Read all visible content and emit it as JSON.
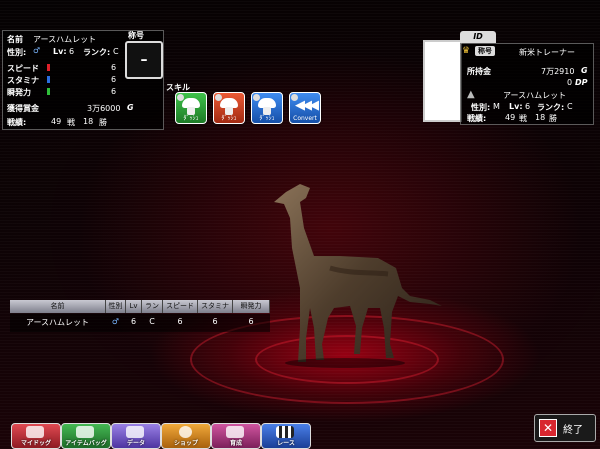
{
  "status": {
    "name_label": "名前",
    "name": "アースハムレット",
    "sex_label": "性別:",
    "sex_symbol": "♂",
    "level_label": "Lv:",
    "level": "6",
    "rank_label": "ランク:",
    "rank": "C",
    "title_label": "称号",
    "title_value": "–",
    "stats": [
      {
        "label": "スピード",
        "value": "6",
        "color": "#e0202a"
      },
      {
        "label": "スタミナ",
        "value": "6",
        "color": "#2a6ee0"
      },
      {
        "label": "瞬発力",
        "value": "6",
        "color": "#2fbf3a"
      }
    ],
    "prize_label": "獲得賞金",
    "prize_value": "3万6000",
    "prize_unit": "G",
    "record_label": "戦績:",
    "record_races": "49",
    "record_races_unit": "戦",
    "record_wins": "18",
    "record_wins_unit": "勝"
  },
  "skills": {
    "label": "スキル",
    "items": [
      {
        "icon": "mushroom-skill-icon",
        "color": "#2fa83a",
        "caption": "ﾀﾞｯｼｭ"
      },
      {
        "icon": "mushroom-skill-icon",
        "color": "#d8411f",
        "caption": "ﾀﾞｯｼｭ"
      },
      {
        "icon": "mushroom-skill-icon",
        "color": "#1f6fd8",
        "caption": "ﾀﾞｯｼｭ"
      },
      {
        "icon": "chevron-skill-icon",
        "color": "#1f6fd8",
        "caption": "Convert"
      }
    ]
  },
  "trainer": {
    "id_label": "ID",
    "title_label": "称号",
    "name": "新米トレーナー",
    "money_label": "所持金",
    "money_value": "7万2910",
    "money_unit": "G",
    "dp_value": "0",
    "dp_unit": "DP",
    "dog_name": "アースハムレット",
    "dog_sex_label": "性別:",
    "dog_sex": "M",
    "dog_level_label": "Lv:",
    "dog_level": "6",
    "dog_rank_label": "ランク:",
    "dog_rank": "C",
    "record_label": "戦績:",
    "record_races": "49",
    "record_races_unit": "戦",
    "record_wins": "18",
    "record_wins_unit": "勝"
  },
  "table": {
    "headers": [
      "名前",
      "性別",
      "Lv",
      "ランク",
      "スピード",
      "スタミナ",
      "瞬発力"
    ],
    "row": [
      "アースハムレット",
      "♂",
      "6",
      "C",
      "6",
      "6",
      "6"
    ]
  },
  "menu": [
    {
      "label": "マイドッグ",
      "color": "#c9303a"
    },
    {
      "label": "アイテムバッグ",
      "color": "#2e9b3c"
    },
    {
      "label": "データ",
      "color": "#7a5bd0"
    },
    {
      "label": "ショップ",
      "color": "#d98e1c"
    },
    {
      "label": "育成",
      "color": "#b43a86"
    },
    {
      "label": "レース",
      "color": "#2a5fd0"
    }
  ],
  "exit_label": "終了"
}
